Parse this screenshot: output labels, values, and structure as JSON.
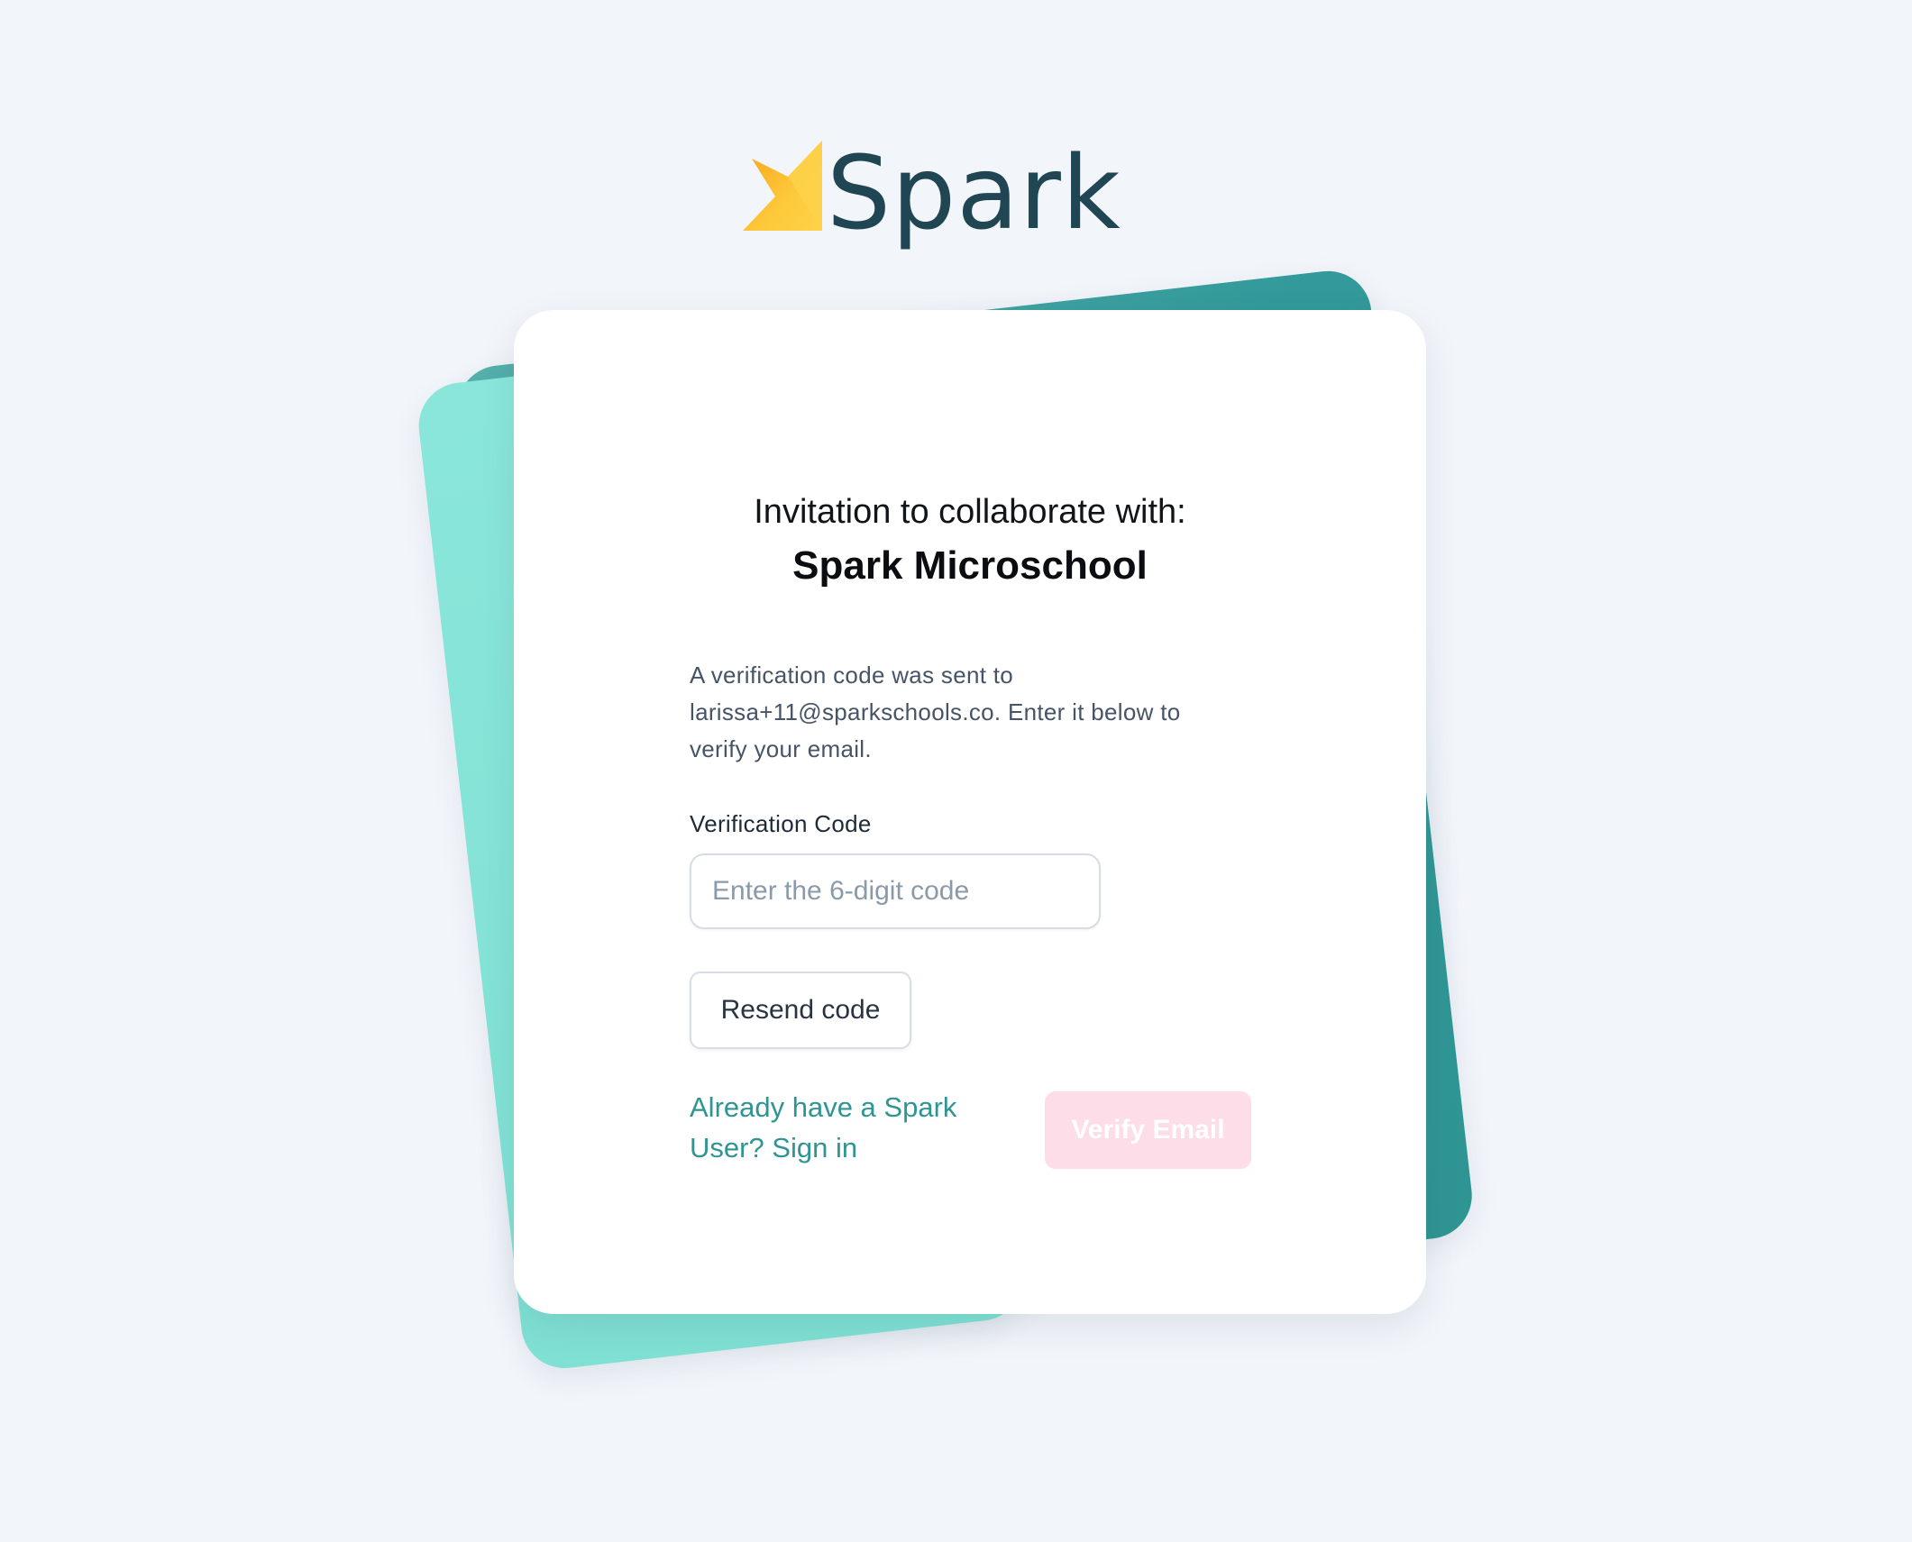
{
  "brand": {
    "name": "Spark",
    "logo_icon": "spark-flame-icon",
    "text_color": "#1f4652",
    "accent_gold": "#fbbf24"
  },
  "card": {
    "invite_text": "Invitation to collaborate with:",
    "organization": "Spark Microschool",
    "info_text": "A verification code was sent to larissa+11@sparkschools.co. Enter it below to verify your email.",
    "code_field": {
      "label": "Verification Code",
      "value": "",
      "placeholder": "Enter the 6-digit code"
    },
    "resend_label": "Resend code",
    "signin_text": "Already have a Spark User? Sign in",
    "verify_label": "Verify Email"
  },
  "colors": {
    "background": "#f2f5fa",
    "teal_dark": "#2f9593",
    "teal_light": "#7edfd2",
    "link": "#2f9593",
    "verify_disabled_bg": "#fcdde8"
  }
}
